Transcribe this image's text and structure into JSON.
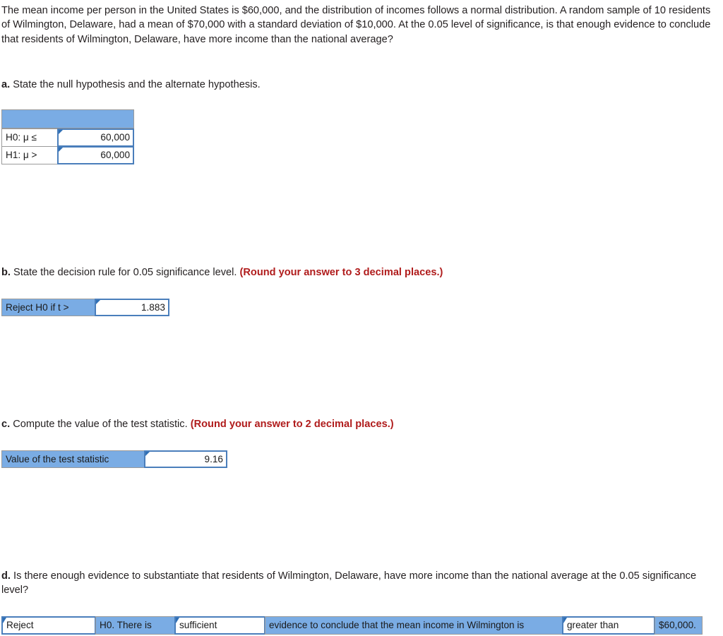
{
  "problem": {
    "intro": "The mean income per person in the United States is $60,000, and the distribution of incomes follows a normal distribution. A random sample of 10 residents of Wilmington, Delaware, had a mean of $70,000 with a standard deviation of $10,000. At the 0.05 level of significance, is that enough evidence to conclude that residents of Wilmington, Delaware, have more income than the national average?"
  },
  "parts": {
    "a": {
      "letter": "a.",
      "text": "State the null hypothesis and the alternate hypothesis.",
      "table": {
        "header_label": "",
        "rows": [
          {
            "label": "H0: μ ≤",
            "value": "60,000"
          },
          {
            "label": "H1: μ >",
            "value": "60,000"
          }
        ]
      }
    },
    "b": {
      "letter": "b.",
      "text": "State the decision rule for 0.05 significance level.",
      "round_note": "(Round your answer to 3 decimal places.)",
      "label": "Reject H0 if t >",
      "value": "1.883"
    },
    "c": {
      "letter": "c.",
      "text": "Compute the value of the test statistic.",
      "round_note": "(Round your answer to 2 decimal places.)",
      "label": "Value of the test statistic",
      "value": "9.16"
    },
    "d": {
      "letter": "d.",
      "text": "Is there enough evidence to substantiate that residents of Wilmington, Delaware, have more income than the national average at the 0.05 significance level?",
      "conclusion": {
        "decision": "Reject",
        "text_1": "H0. There is",
        "sufficiency": "sufficient",
        "text_2": "evidence to conclude that the mean income in Wilmington is",
        "comparison": "greater than",
        "amount": "$60,000."
      }
    }
  },
  "colors": {
    "label_blue": "#7aace4",
    "input_border": "#4a7ebb",
    "flag_blue": "#2f6fb5",
    "note_red": "#b01c1c",
    "grey_border": "#9a9a9a"
  }
}
